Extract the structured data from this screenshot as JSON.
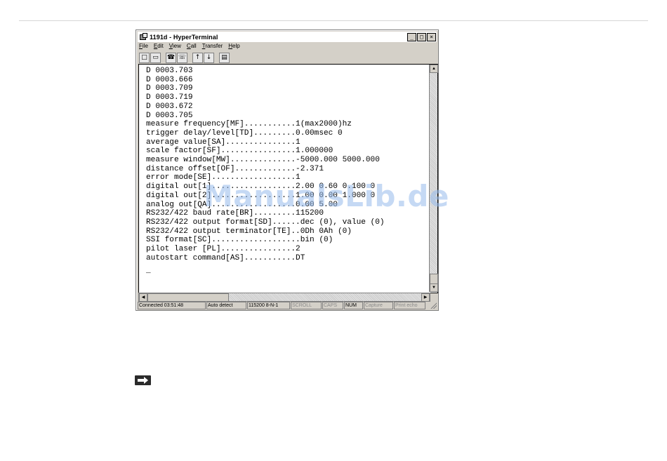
{
  "window": {
    "title": "1191d - HyperTerminal",
    "controls": {
      "minimize": "_",
      "maximize": "□",
      "close": "×"
    }
  },
  "menu": [
    "File",
    "Edit",
    "View",
    "Call",
    "Transfer",
    "Help"
  ],
  "toolbar_icons": [
    "new-icon",
    "open-icon",
    "disconnect-icon",
    "connect-icon",
    "send-icon",
    "receive-icon",
    "properties-icon"
  ],
  "terminal": {
    "lines": [
      "D 0003.703",
      "D 0003.666",
      "D 0003.709",
      "D 0003.719",
      "D 0003.672",
      "D 0003.705",
      "measure frequency[MF]...........1(max2000)hz",
      "trigger delay/level[TD].........0.00msec 0",
      "average value[SA]...............1",
      "scale factor[SF]................1.000000",
      "measure window[MW]..............-5000.000 5000.000",
      "distance offset[OF].............-2.371",
      "error mode[SE]..................1",
      "digital out[1]..................2.00 0.60 0.100 0",
      "digital out[2]..................1.00 0.00 1.000 0",
      "analog out[QA]..................0.00 5.00",
      "RS232/422 baud rate[BR].........115200",
      "RS232/422 output format[SD]......dec (0), value (0)",
      "RS232/422 output terminator[TE]..0Dh 0Ah (0)",
      "SSI format[SC]...................bin (0)",
      "pilot laser [PL]................2",
      "autostart command[AS]...........DT"
    ],
    "cursor": "_"
  },
  "statusbar": [
    {
      "text": "Connected 03:51:48",
      "active": true
    },
    {
      "text": "Auto detect",
      "active": true
    },
    {
      "text": "115200 8-N-1",
      "active": true
    },
    {
      "text": "SCROLL",
      "active": false
    },
    {
      "text": "CAPS",
      "active": false
    },
    {
      "text": "NUM",
      "active": true
    },
    {
      "text": "Capture",
      "active": false
    },
    {
      "text": "Print echo",
      "active": false
    }
  ],
  "watermark": "ManualsLib.de"
}
